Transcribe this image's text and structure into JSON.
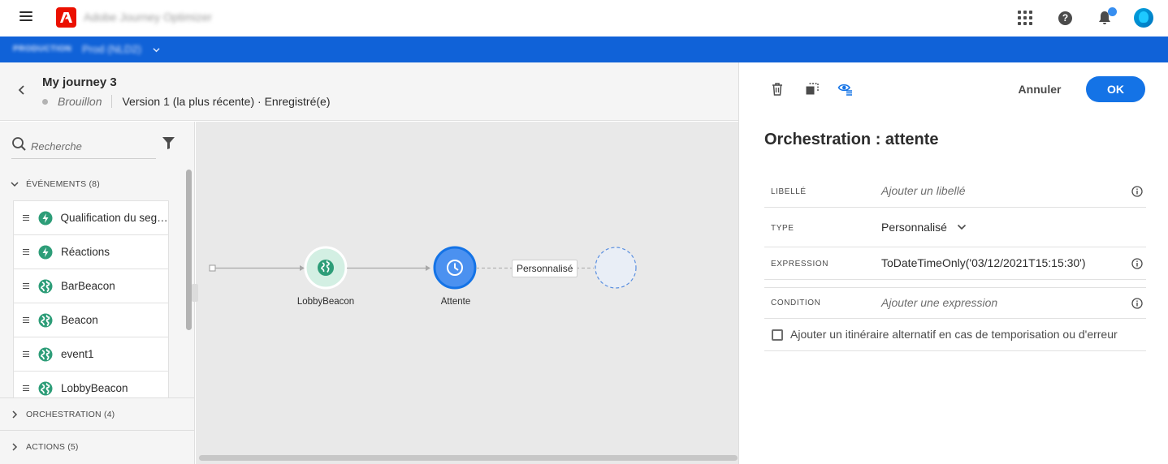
{
  "app": {
    "title": "Adobe Journey Optimizer"
  },
  "env": {
    "label": "PRODUCTION",
    "value": "Prod (NLD2)"
  },
  "journey": {
    "title": "My journey 3",
    "status": "Brouillon",
    "version": "Version 1 (la plus récente) · Enregistré(e)"
  },
  "sidebar": {
    "search_placeholder": "Recherche",
    "events_header": "ÉVÉNEMENTS (8)",
    "events": [
      {
        "label": "Qualification du segm...",
        "icon": "segment-lightning-icon"
      },
      {
        "label": "Réactions",
        "icon": "lightning-icon"
      },
      {
        "label": "BarBeacon",
        "icon": "globe-icon"
      },
      {
        "label": "Beacon",
        "icon": "globe-icon"
      },
      {
        "label": "event1",
        "icon": "globe-icon"
      },
      {
        "label": "LobbyBeacon",
        "icon": "globe-icon"
      }
    ],
    "orchestration_header": "ORCHESTRATION (4)",
    "actions_header": "ACTIONS (5)"
  },
  "canvas": {
    "nodes": [
      {
        "label": "LobbyBeacon",
        "icon": "globe-icon"
      },
      {
        "label": "Attente",
        "icon": "clock-icon"
      }
    ],
    "path_label": "Personnalisé"
  },
  "panel": {
    "title": "Orchestration : attente",
    "cancel_label": "Annuler",
    "ok_label": "OK",
    "fields": {
      "libelle_key": "LIBELLÉ",
      "libelle_placeholder": "Ajouter un libellé",
      "type_key": "TYPE",
      "type_value": "Personnalisé",
      "expression_key": "EXPRESSION",
      "expression_value": "ToDateTimeOnly('03/12/2021T15:15:30')",
      "condition_key": "CONDITION",
      "condition_placeholder": "Ajouter une expression"
    },
    "alt_path_label": "Ajouter un itinéraire alternatif en cas de temporisation ou d'erreur"
  },
  "colors": {
    "env_bar": "#1062d8",
    "accent": "#1473e6",
    "event_green": "#2d9d78",
    "adobe_red": "#eb1000"
  }
}
